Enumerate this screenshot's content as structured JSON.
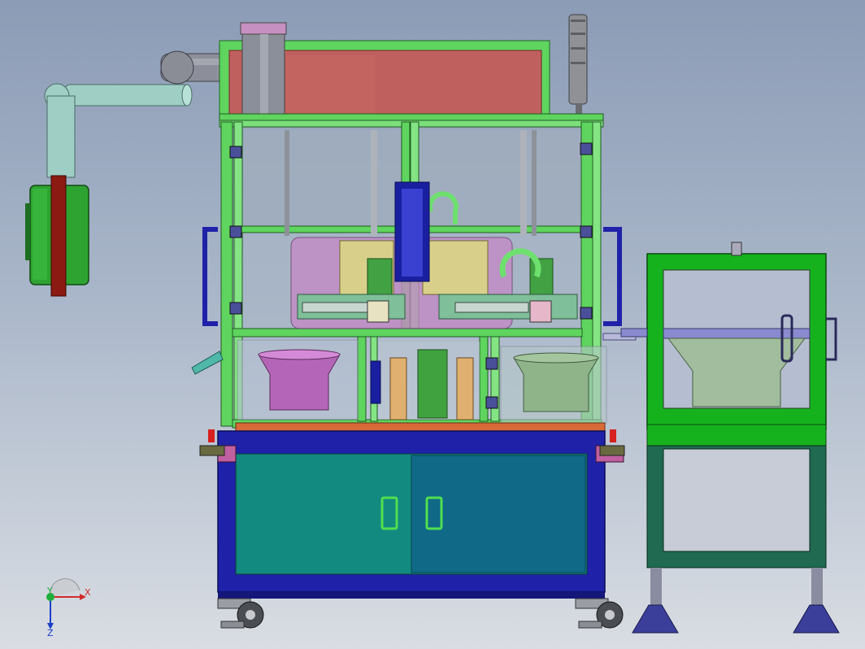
{
  "axis_triad": {
    "x_label": "X",
    "y_label": "Y",
    "z_label": "Z",
    "x_color": "#d22a2a",
    "y_color": "#1fae3a",
    "z_color": "#1c3ec8"
  },
  "colors": {
    "frame_green": "#5fd45f",
    "base_blue": "#1f22a8",
    "cabinet_teal": "#138a80",
    "cabinet_dark": "#0f5f8a",
    "duct_gray": "#8c8f99",
    "duct_light": "#9fcfc4",
    "filter_green": "#2ea332",
    "filter_red": "#8a1a12",
    "back_panel": "#c0605e",
    "magenta_part": "#c060c0",
    "yellow_plate": "#d8d08a",
    "side_cabinet_green": "#16b21e",
    "foot_blue": "#3c3f9a"
  },
  "icons": {
    "caster_wheel": "caster-wheel-icon",
    "door_handle": "door-handle-icon",
    "stack_light": "signal-tower-icon"
  }
}
